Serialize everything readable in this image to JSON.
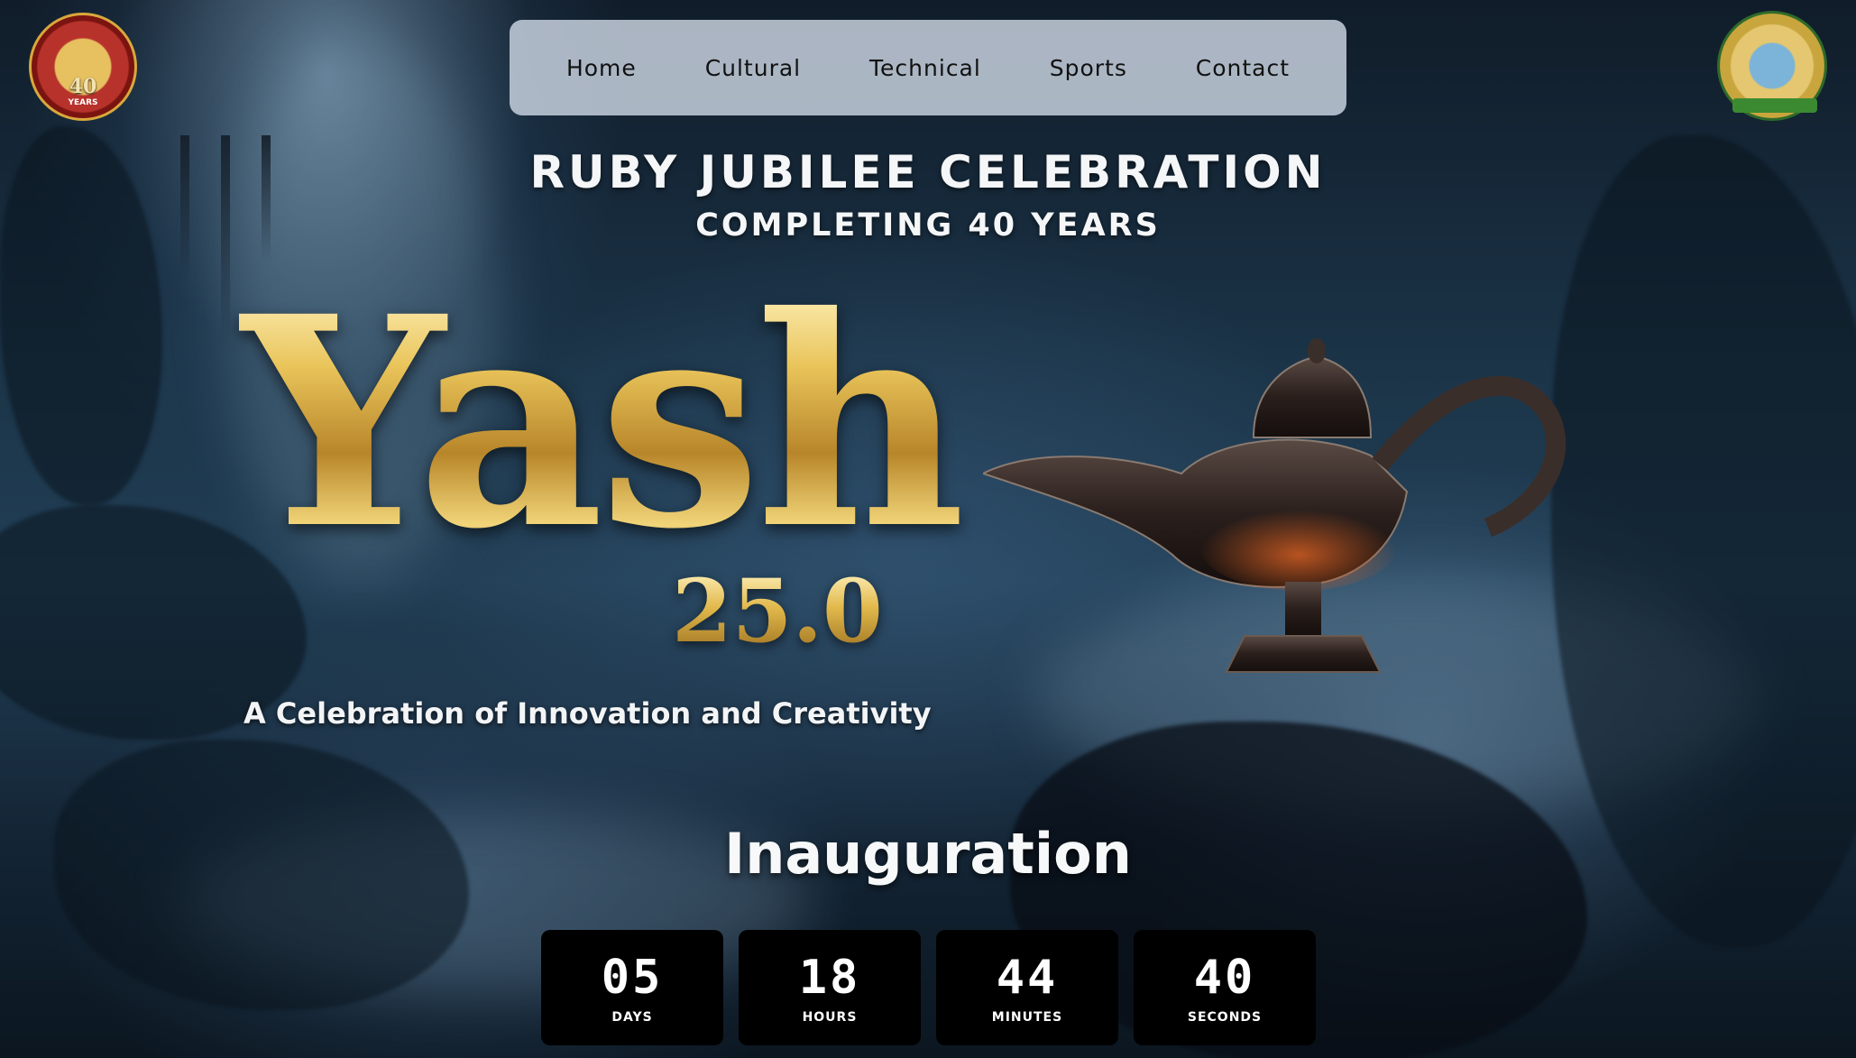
{
  "nav": {
    "items": [
      {
        "label": "Home"
      },
      {
        "label": "Cultural"
      },
      {
        "label": "Technical"
      },
      {
        "label": "Sports"
      },
      {
        "label": "Contact"
      }
    ]
  },
  "logos": {
    "left": {
      "badge_number": "40",
      "badge_text": "YEARS"
    }
  },
  "hero": {
    "heading": "RUBY JUBILEE CELEBRATION",
    "subheading": "COMPLETING 40 YEARS",
    "title": "Yash",
    "version": "25.0",
    "tagline": "A Celebration of Innovation and Creativity"
  },
  "event": {
    "name": "Inauguration"
  },
  "countdown": [
    {
      "value": "05",
      "label": "DAYS"
    },
    {
      "value": "18",
      "label": "HOURS"
    },
    {
      "value": "44",
      "label": "MINUTES"
    },
    {
      "value": "40",
      "label": "SECONDS"
    }
  ],
  "colors": {
    "gold": "#e2b94c",
    "nav_background": "#cdd7e4",
    "countdown_box": "#000000"
  }
}
